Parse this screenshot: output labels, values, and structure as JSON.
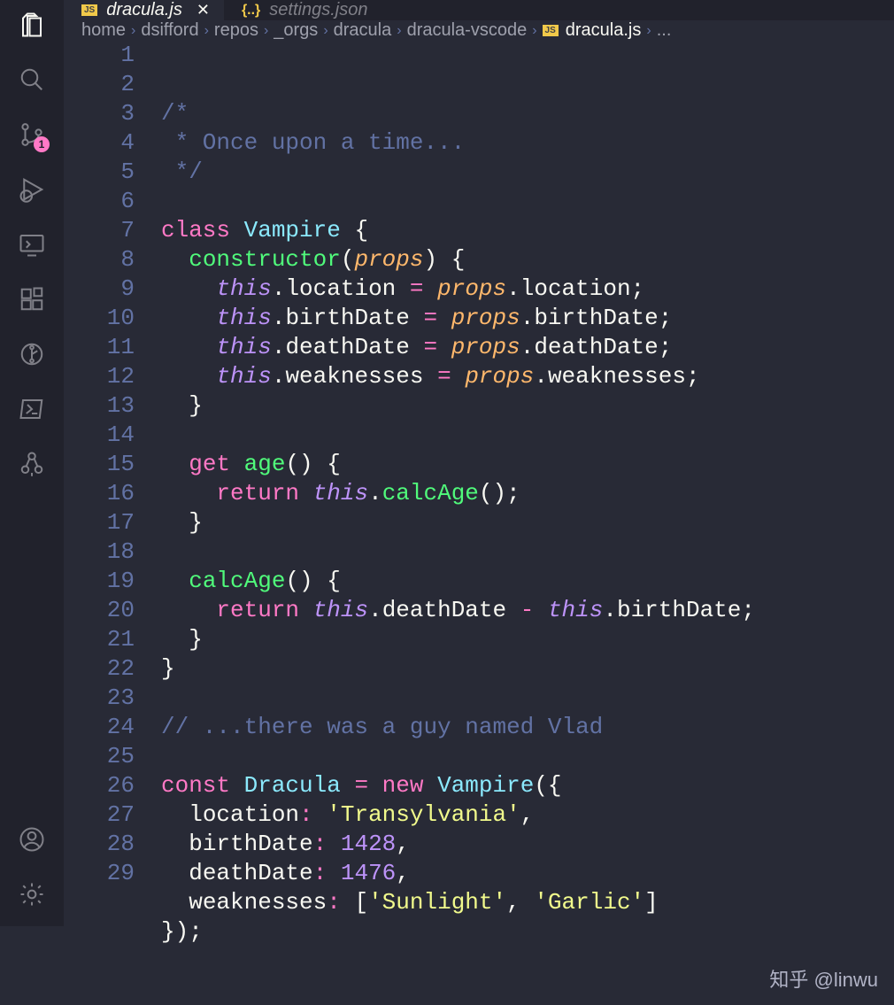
{
  "activity_bar": {
    "items": [
      {
        "name": "explorer-icon",
        "active": true
      },
      {
        "name": "search-icon"
      },
      {
        "name": "source-control-icon",
        "badge": "1"
      },
      {
        "name": "run-debug-icon"
      },
      {
        "name": "remote-icon"
      },
      {
        "name": "extensions-icon"
      },
      {
        "name": "git-graph-icon"
      },
      {
        "name": "powershell-icon"
      },
      {
        "name": "tree-icon"
      }
    ],
    "bottom": [
      {
        "name": "accounts-icon"
      },
      {
        "name": "settings-gear-icon"
      }
    ]
  },
  "tabs": [
    {
      "icon": "JS",
      "label": "dracula.js",
      "active": true,
      "close": true
    },
    {
      "icon": "{..}",
      "label": "settings.json",
      "active": false,
      "close": false
    }
  ],
  "breadcrumbs": [
    "home",
    "dsifford",
    "repos",
    "_orgs",
    "dracula",
    "dracula-vscode"
  ],
  "breadcrumb_file": {
    "icon": "JS",
    "name": "dracula.js",
    "tail": "..."
  },
  "scm_badge": "1",
  "code": {
    "lines": [
      {
        "t": [
          [
            "cmt",
            "/*"
          ]
        ]
      },
      {
        "t": [
          [
            "cmt",
            " * Once upon a time..."
          ]
        ]
      },
      {
        "t": [
          [
            "cmt",
            " */"
          ]
        ]
      },
      {
        "t": []
      },
      {
        "t": [
          [
            "kw",
            "class"
          ],
          [
            "sp",
            " "
          ],
          [
            "cls",
            "Vampire"
          ],
          [
            "sp",
            " "
          ],
          [
            "punc",
            "{"
          ]
        ]
      },
      {
        "t": [
          [
            "sp",
            "  "
          ],
          [
            "fn",
            "constructor"
          ],
          [
            "punc",
            "("
          ],
          [
            "param",
            "props"
          ],
          [
            "punc",
            ")"
          ],
          [
            "sp",
            " "
          ],
          [
            "punc",
            "{"
          ]
        ]
      },
      {
        "t": [
          [
            "sp",
            "    "
          ],
          [
            "this",
            "this"
          ],
          [
            "dot",
            "."
          ],
          [
            "punc",
            "location "
          ],
          [
            "kw",
            "="
          ],
          [
            "sp",
            " "
          ],
          [
            "param",
            "props"
          ],
          [
            "dot",
            "."
          ],
          [
            "punc",
            "location;"
          ]
        ]
      },
      {
        "t": [
          [
            "sp",
            "    "
          ],
          [
            "this",
            "this"
          ],
          [
            "dot",
            "."
          ],
          [
            "punc",
            "birthDate "
          ],
          [
            "kw",
            "="
          ],
          [
            "sp",
            " "
          ],
          [
            "param",
            "props"
          ],
          [
            "dot",
            "."
          ],
          [
            "punc",
            "birthDate;"
          ]
        ]
      },
      {
        "t": [
          [
            "sp",
            "    "
          ],
          [
            "this",
            "this"
          ],
          [
            "dot",
            "."
          ],
          [
            "punc",
            "deathDate "
          ],
          [
            "kw",
            "="
          ],
          [
            "sp",
            " "
          ],
          [
            "param",
            "props"
          ],
          [
            "dot",
            "."
          ],
          [
            "punc",
            "deathDate;"
          ]
        ]
      },
      {
        "t": [
          [
            "sp",
            "    "
          ],
          [
            "this",
            "this"
          ],
          [
            "dot",
            "."
          ],
          [
            "punc",
            "weaknesses "
          ],
          [
            "kw",
            "="
          ],
          [
            "sp",
            " "
          ],
          [
            "param",
            "props"
          ],
          [
            "dot",
            "."
          ],
          [
            "punc",
            "weaknesses;"
          ]
        ]
      },
      {
        "t": [
          [
            "sp",
            "  "
          ],
          [
            "punc",
            "}"
          ]
        ]
      },
      {
        "t": []
      },
      {
        "t": [
          [
            "sp",
            "  "
          ],
          [
            "kw",
            "get"
          ],
          [
            "sp",
            " "
          ],
          [
            "fn",
            "age"
          ],
          [
            "punc",
            "()"
          ],
          [
            "sp",
            " "
          ],
          [
            "punc",
            "{"
          ]
        ]
      },
      {
        "t": [
          [
            "sp",
            "    "
          ],
          [
            "kw",
            "return"
          ],
          [
            "sp",
            " "
          ],
          [
            "this",
            "this"
          ],
          [
            "dot",
            "."
          ],
          [
            "fn",
            "calcAge"
          ],
          [
            "punc",
            "();"
          ]
        ]
      },
      {
        "t": [
          [
            "sp",
            "  "
          ],
          [
            "punc",
            "}"
          ]
        ]
      },
      {
        "t": []
      },
      {
        "t": [
          [
            "sp",
            "  "
          ],
          [
            "fn",
            "calcAge"
          ],
          [
            "punc",
            "()"
          ],
          [
            "sp",
            " "
          ],
          [
            "punc",
            "{"
          ]
        ]
      },
      {
        "t": [
          [
            "sp",
            "    "
          ],
          [
            "kw",
            "return"
          ],
          [
            "sp",
            " "
          ],
          [
            "this",
            "this"
          ],
          [
            "dot",
            "."
          ],
          [
            "punc",
            "deathDate "
          ],
          [
            "kw",
            "-"
          ],
          [
            "sp",
            " "
          ],
          [
            "this",
            "this"
          ],
          [
            "dot",
            "."
          ],
          [
            "punc",
            "birthDate;"
          ]
        ]
      },
      {
        "t": [
          [
            "sp",
            "  "
          ],
          [
            "punc",
            "}"
          ]
        ]
      },
      {
        "t": [
          [
            "punc",
            "}"
          ]
        ]
      },
      {
        "t": []
      },
      {
        "t": [
          [
            "cmt",
            "// ...there was a guy named Vlad"
          ]
        ]
      },
      {
        "t": []
      },
      {
        "t": [
          [
            "kw",
            "const"
          ],
          [
            "sp",
            " "
          ],
          [
            "cls",
            "Dracula"
          ],
          [
            "sp",
            " "
          ],
          [
            "kw",
            "="
          ],
          [
            "sp",
            " "
          ],
          [
            "kw",
            "new"
          ],
          [
            "sp",
            " "
          ],
          [
            "cls",
            "Vampire"
          ],
          [
            "punc",
            "({"
          ]
        ]
      },
      {
        "t": [
          [
            "sp",
            "  "
          ],
          [
            "punc",
            "location"
          ],
          [
            "kw",
            ":"
          ],
          [
            "sp",
            " "
          ],
          [
            "str",
            "'Transylvania'"
          ],
          [
            "punc",
            ","
          ]
        ]
      },
      {
        "t": [
          [
            "sp",
            "  "
          ],
          [
            "punc",
            "birthDate"
          ],
          [
            "kw",
            ":"
          ],
          [
            "sp",
            " "
          ],
          [
            "num",
            "1428"
          ],
          [
            "punc",
            ","
          ]
        ]
      },
      {
        "t": [
          [
            "sp",
            "  "
          ],
          [
            "punc",
            "deathDate"
          ],
          [
            "kw",
            ":"
          ],
          [
            "sp",
            " "
          ],
          [
            "num",
            "1476"
          ],
          [
            "punc",
            ","
          ]
        ]
      },
      {
        "t": [
          [
            "sp",
            "  "
          ],
          [
            "punc",
            "weaknesses"
          ],
          [
            "kw",
            ":"
          ],
          [
            "sp",
            " "
          ],
          [
            "punc",
            "["
          ],
          [
            "str",
            "'Sunlight'"
          ],
          [
            "punc",
            ", "
          ],
          [
            "str",
            "'Garlic'"
          ],
          [
            "punc",
            "]"
          ]
        ]
      },
      {
        "t": [
          [
            "punc",
            "});"
          ]
        ]
      }
    ]
  },
  "watermark": "知乎 @linwu"
}
